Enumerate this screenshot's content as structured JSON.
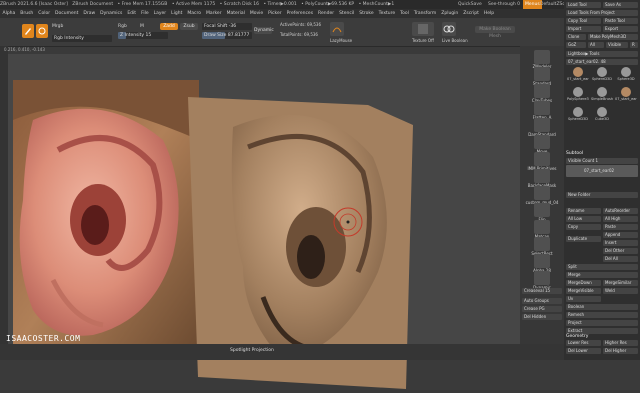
{
  "titlebar": {
    "items": [
      "ZBrush 2021.6.6 [Isaac Oster]",
      "ZBrush Document",
      "• Free Mem 17.155GB",
      "• Active Mem 1175",
      "• Scratch Disk 16",
      "• Timer▶0.001",
      "• PolyCount▶69.536 KP",
      "• MeshCount▶1"
    ],
    "quicksave": "QuickSave",
    "see_through": "See-through 0",
    "menus_btn": "Menus",
    "default_script": "DefaultZScript"
  },
  "menubar": {
    "items": [
      "Alpha",
      "Brush",
      "Color",
      "Document",
      "Draw",
      "Dynamics",
      "Edit",
      "File",
      "Layer",
      "Light",
      "Macro",
      "Marker",
      "Material",
      "Movie",
      "Picker",
      "Preferences",
      "Render",
      "Stencil",
      "Stroke",
      "Texture",
      "Tool",
      "Transform",
      "Zplugin",
      "Zscript",
      "Help"
    ]
  },
  "toolbar": {
    "edit_label": "Edit",
    "draw_label": "Draw",
    "mrgb": "Mrgb",
    "rgb": "Rgb",
    "m": "M",
    "zadd": "Zadd",
    "zsub": "Zsub",
    "zcut": "Zcut",
    "rgb_intensity": "Rgb Intensity",
    "z_intensity": "Z Intensity 15",
    "focal_shift": "Focal Shift -36",
    "draw_size": "Draw Size 87.81777",
    "dynamic": "Dynamic",
    "active_points": "ActivePoints: 69,536",
    "total_points": "TotalPoints: 69,536",
    "lazymouse": "LazyMouse",
    "live_boolean": "Live Boolean",
    "texture_off": "Texture Off",
    "make_boolean_mesh": "Make Boolean Mesh",
    "zadd_active": true,
    "z_intensity_pct": 15
  },
  "subbar": {
    "text": "0.216, 0.410, -0.143"
  },
  "iconcol": {
    "items": [
      "ZModeler",
      "Standard",
      "ClayTubes",
      "Flatten_A",
      "DamStandard",
      "Move",
      "IMM Primitives",
      "BackfaceMask",
      "custom_mud_04",
      "Flip",
      "Matcap",
      "SelectRect",
      "Alpha 28",
      "Dynamic"
    ],
    "creaseval": "Creaseval 15",
    "buttons": [
      "Auto Groups",
      "Crease PG",
      "Del Hidden"
    ]
  },
  "palette": {
    "top_buttons": [
      "Load Tool",
      "Save As",
      "Load Tools From Project",
      "Copy Tool",
      "Paste Tool",
      "Import",
      "Export",
      "Clone",
      "Make PolyMesh3D",
      "GoZ",
      "All",
      "Visible",
      "R"
    ],
    "lightbox_label": "Lightbox▶ Tools",
    "tool_name": "07_start_ear02. 48",
    "subtools": [
      "07_start_ear02",
      "SphereD3D",
      "Sphere3D",
      "PolySphere3D",
      "SimpleBrush",
      "07_start_ear02",
      "SphereD3D",
      "Cube3D"
    ],
    "subtool_header": "Subtool",
    "visible_count": "Visible Count 1",
    "subtool_item": "07_start_ear02",
    "subtool_buttons": [
      "New Folder",
      "Rename",
      "AutoReorder",
      "All Low",
      "All High",
      "Copy",
      "Paste",
      "Duplicate",
      "Append",
      "Insert",
      "Del Other",
      "Del All",
      "Split",
      "Merge",
      "MergeDown",
      "MergeSimilar",
      "MergeVisible",
      "Weld",
      "Uv",
      "Boolean",
      "Remesh",
      "Project",
      "Extract"
    ],
    "geometry_header": "Geometry",
    "geometry_buttons": [
      "Lower Res",
      "Higher Res",
      "Del Lower",
      "Del Higher"
    ]
  },
  "bottom": {
    "watermark": "ISAACOSTER.COM",
    "spotlight": "Spotlight Projection"
  },
  "colors": {
    "accent": "#e0851c",
    "bg": "#3a3a3a",
    "canvas": "#464646",
    "clay": "#a3805f"
  }
}
